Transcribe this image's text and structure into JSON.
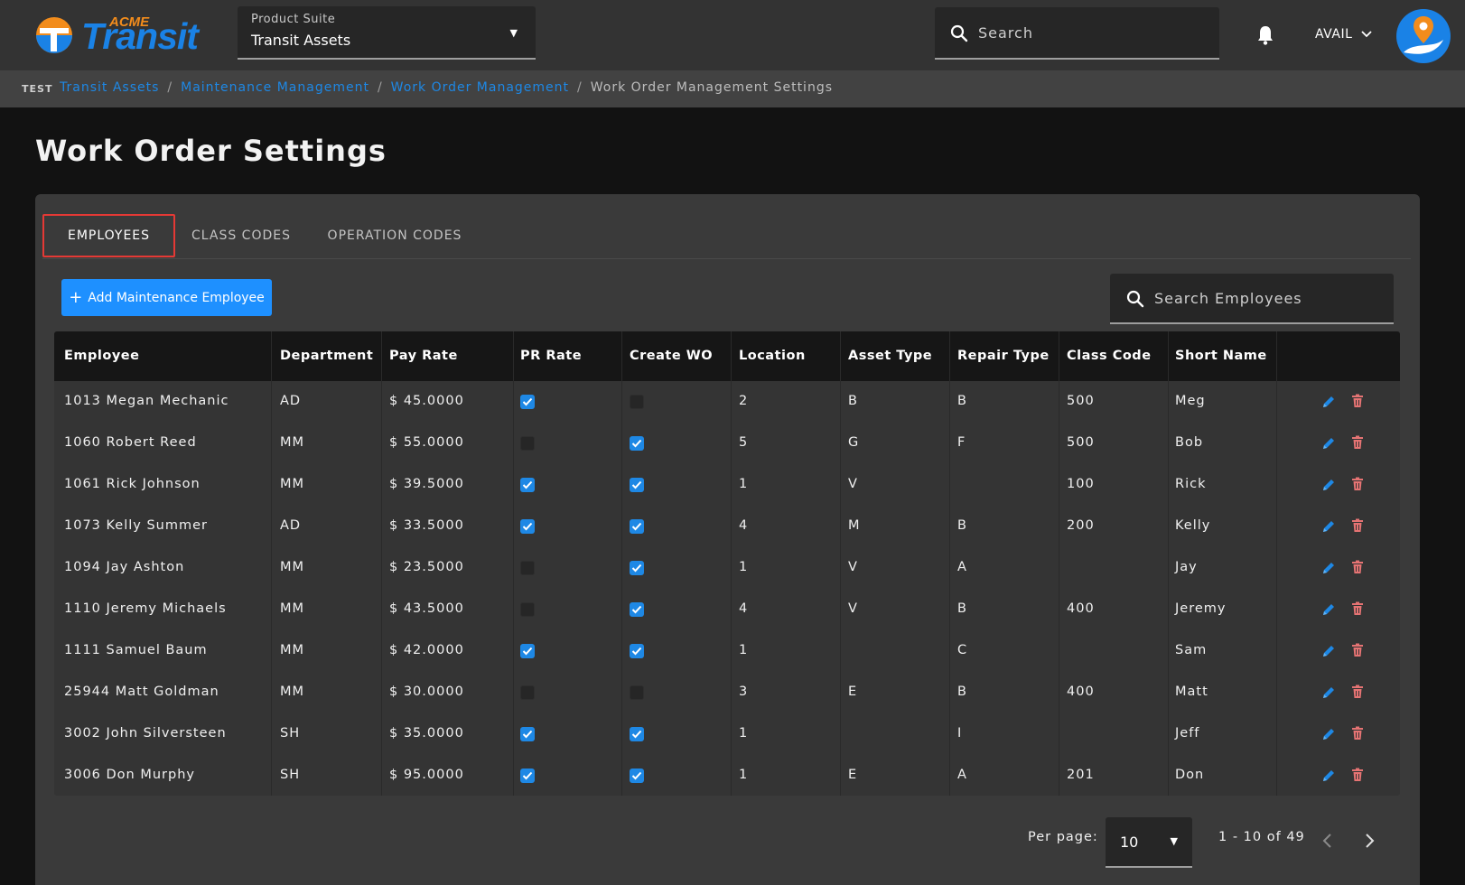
{
  "brand": {
    "acme": "ACME",
    "word": "Transit"
  },
  "suite": {
    "label": "Product Suite",
    "value": "Transit Assets"
  },
  "search": {
    "placeholder": "Search"
  },
  "user": {
    "name": "AVAIL"
  },
  "breadcrumb": {
    "env": "TEST",
    "items": [
      "Transit Assets",
      "Maintenance Management",
      "Work Order Management"
    ],
    "current": "Work Order Management Settings"
  },
  "page": {
    "title": "Work Order Settings"
  },
  "tabs": [
    "EMPLOYEES",
    "CLASS CODES",
    "OPERATION CODES"
  ],
  "toolbar": {
    "add_label": "Add Maintenance Employee",
    "search_placeholder": "Search Employees"
  },
  "table": {
    "headers": [
      "Employee",
      "Department",
      "Pay Rate",
      "PR Rate",
      "Create WO",
      "Location",
      "Asset Type",
      "Repair Type",
      "Class Code",
      "Short Name"
    ],
    "rows": [
      {
        "employee": "1013 Megan Mechanic",
        "department": "AD",
        "pay_rate": "$ 45.0000",
        "pr_rate": true,
        "create_wo": false,
        "location": "2",
        "asset_type": "B",
        "repair_type": "B",
        "class_code": "500",
        "short_name": "Meg"
      },
      {
        "employee": "1060 Robert Reed",
        "department": "MM",
        "pay_rate": "$ 55.0000",
        "pr_rate": false,
        "create_wo": true,
        "location": "5",
        "asset_type": "G",
        "repair_type": "F",
        "class_code": "500",
        "short_name": "Bob"
      },
      {
        "employee": "1061 Rick Johnson",
        "department": "MM",
        "pay_rate": "$ 39.5000",
        "pr_rate": true,
        "create_wo": true,
        "location": "1",
        "asset_type": "V",
        "repair_type": "",
        "class_code": "100",
        "short_name": "Rick"
      },
      {
        "employee": "1073 Kelly Summer",
        "department": "AD",
        "pay_rate": "$ 33.5000",
        "pr_rate": true,
        "create_wo": true,
        "location": "4",
        "asset_type": "M",
        "repair_type": "B",
        "class_code": "200",
        "short_name": "Kelly"
      },
      {
        "employee": "1094 Jay Ashton",
        "department": "MM",
        "pay_rate": "$ 23.5000",
        "pr_rate": false,
        "create_wo": true,
        "location": "1",
        "asset_type": "V",
        "repair_type": "A",
        "class_code": "",
        "short_name": "Jay"
      },
      {
        "employee": "1110 Jeremy Michaels",
        "department": "MM",
        "pay_rate": "$ 43.5000",
        "pr_rate": false,
        "create_wo": true,
        "location": "4",
        "asset_type": "V",
        "repair_type": "B",
        "class_code": "400",
        "short_name": "Jeremy"
      },
      {
        "employee": "1111 Samuel Baum",
        "department": "MM",
        "pay_rate": "$ 42.0000",
        "pr_rate": true,
        "create_wo": true,
        "location": "1",
        "asset_type": "",
        "repair_type": "C",
        "class_code": "",
        "short_name": "Sam"
      },
      {
        "employee": "25944 Matt Goldman",
        "department": "MM",
        "pay_rate": "$ 30.0000",
        "pr_rate": false,
        "create_wo": false,
        "location": "3",
        "asset_type": "E",
        "repair_type": "B",
        "class_code": "400",
        "short_name": "Matt"
      },
      {
        "employee": "3002 John Silversteen",
        "department": "SH",
        "pay_rate": "$ 35.0000",
        "pr_rate": true,
        "create_wo": true,
        "location": "1",
        "asset_type": "",
        "repair_type": "I",
        "class_code": "",
        "short_name": "Jeff"
      },
      {
        "employee": "3006 Don Murphy",
        "department": "SH",
        "pay_rate": "$ 95.0000",
        "pr_rate": true,
        "create_wo": true,
        "location": "1",
        "asset_type": "E",
        "repair_type": "A",
        "class_code": "201",
        "short_name": "Don"
      }
    ]
  },
  "pagination": {
    "label": "Per page:",
    "value": "10",
    "range": "1 - 10 of 49"
  },
  "colors": {
    "accent": "#1e90ff",
    "active_tab_border": "#e53935",
    "delete": "#e57373",
    "logo_orange": "#f28c1c"
  },
  "icons": [
    "search-icon",
    "bell-icon",
    "chevron-down-icon",
    "plus-icon",
    "edit-icon",
    "trash-icon",
    "chevron-left-icon",
    "chevron-right-icon"
  ]
}
